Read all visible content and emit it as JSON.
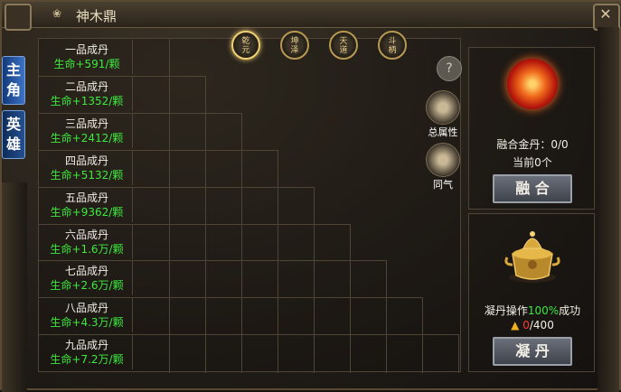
{
  "window": {
    "title": "神木鼎",
    "close_glyph": "✕"
  },
  "side_tabs": [
    {
      "label": "主角",
      "active": true
    },
    {
      "label": "英雄",
      "active": false
    }
  ],
  "top_buttons": [
    {
      "label": "乾元",
      "active": true
    },
    {
      "label": "坤泽",
      "active": false
    },
    {
      "label": "天道",
      "active": false
    },
    {
      "label": "斗柄",
      "active": false
    }
  ],
  "help": {
    "glyph": "?"
  },
  "attr_buttons": [
    {
      "label": "总属性",
      "icon": "robe-icon"
    },
    {
      "label": "同气",
      "icon": "swirl-icon"
    }
  ],
  "elixirs": [
    {
      "grade": "一品成丹",
      "bonus": "生命+591/颗"
    },
    {
      "grade": "二品成丹",
      "bonus": "生命+1352/颗"
    },
    {
      "grade": "三品成丹",
      "bonus": "生命+2412/颗"
    },
    {
      "grade": "四品成丹",
      "bonus": "生命+5132/颗"
    },
    {
      "grade": "五品成丹",
      "bonus": "生命+9362/颗"
    },
    {
      "grade": "六品成丹",
      "bonus": "生命+1.6万/颗"
    },
    {
      "grade": "七品成丹",
      "bonus": "生命+2.6万/颗"
    },
    {
      "grade": "八品成丹",
      "bonus": "生命+4.3万/颗"
    },
    {
      "grade": "九品成丹",
      "bonus": "生命+7.2万/颗"
    }
  ],
  "fusion": {
    "gold_label": "融合金丹：0/0",
    "current_label": "当前0个",
    "button": "融 合"
  },
  "condense": {
    "op_prefix": "凝丹操作",
    "op_percent": "100%",
    "op_suffix": "成功",
    "count_current": "0",
    "count_total": "/400",
    "button": "凝 丹"
  }
}
